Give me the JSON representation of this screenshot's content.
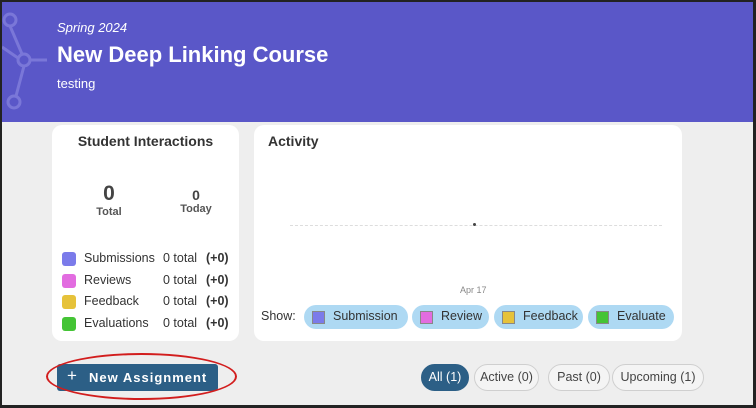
{
  "course": {
    "semester": "Spring 2024",
    "title": "New Deep Linking Course",
    "subtitle": "testing"
  },
  "student_interactions": {
    "title": "Student Interactions",
    "total_value": "0",
    "total_label": "Total",
    "today_value": "0",
    "today_label": "Today",
    "legend": [
      {
        "name": "Submissions",
        "total": "0 total",
        "delta": "(+0)",
        "color": "#7b7bea"
      },
      {
        "name": "Reviews",
        "total": "0 total",
        "delta": "(+0)",
        "color": "#e26ce0"
      },
      {
        "name": "Feedback",
        "total": "0 total",
        "delta": "(+0)",
        "color": "#e6c23a"
      },
      {
        "name": "Evaluations",
        "total": "0 total",
        "delta": "(+0)",
        "color": "#44c435"
      }
    ]
  },
  "activity": {
    "title": "Activity",
    "x_label": "Apr 17",
    "show_label": "Show:",
    "filters": [
      {
        "label": "Submission",
        "color": "#7b7bea"
      },
      {
        "label": "Review",
        "color": "#e26ce0"
      },
      {
        "label": "Feedback",
        "color": "#e6c23a"
      },
      {
        "label": "Evaluate",
        "color": "#44c435"
      }
    ]
  },
  "actions": {
    "new_assignment": "New Assignment",
    "plus": "+"
  },
  "assignment_filters": [
    {
      "label": "All (1)",
      "active": true
    },
    {
      "label": "Active (0)",
      "active": false
    },
    {
      "label": "Past (0)",
      "active": false
    },
    {
      "label": "Upcoming (1)",
      "active": false
    }
  ],
  "colors": {
    "banner": "#5a57c8",
    "primary_button": "#2c5f86",
    "pill": "#aed9f3",
    "annotation": "#d21d1d"
  }
}
